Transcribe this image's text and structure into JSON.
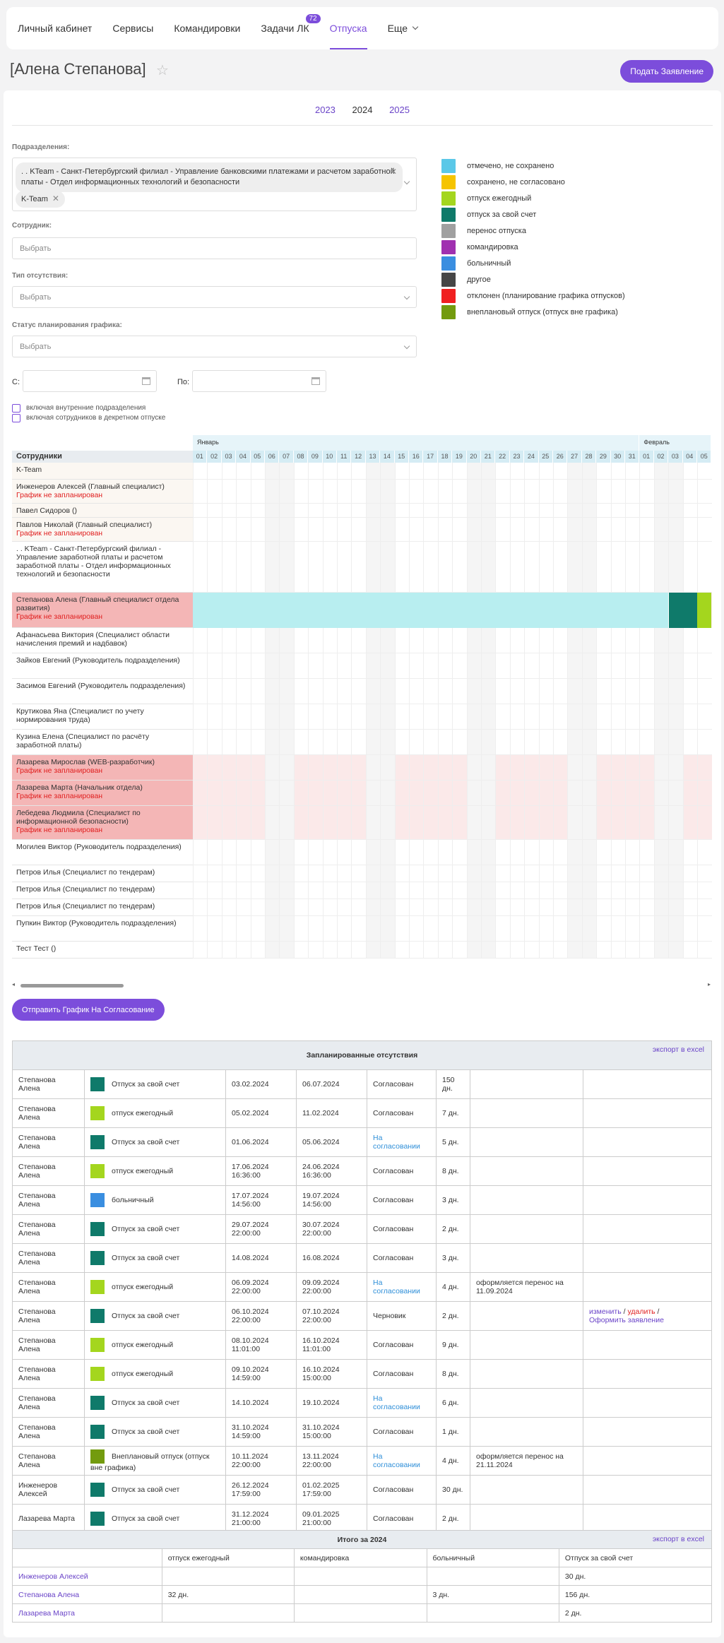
{
  "nav": {
    "items": [
      "Личный кабинет",
      "Сервисы",
      "Командировки",
      "Задачи ЛК",
      "Отпуска",
      "Еще"
    ],
    "badge": "72",
    "active_index": 4
  },
  "page": {
    "title": "[Алена Степанова]",
    "apply_button": "Подать Заявление"
  },
  "years": [
    "2023",
    "2024",
    "2025"
  ],
  "filters": {
    "dept_label": "Подразделения:",
    "dept_chip1": ". . KTeam - Санкт-Петербургский филиал - Управление банковскими платежами и расчетом заработной платы - Отдел информационных технологий и безопасности",
    "dept_chip2": "K-Team",
    "employee_label": "Сотрудник:",
    "employee_placeholder": "Выбрать",
    "absence_label": "Тип отсутствия:",
    "absence_placeholder": "Выбрать",
    "status_label": "Статус планирования графика:",
    "status_placeholder": "Выбрать",
    "from_label": "С:",
    "to_label": "По:",
    "cb1": "включая внутренние подразделения",
    "cb2": "включая сотрудников в декретном отпуске"
  },
  "legend": [
    {
      "label": "отмечено, не сохранено",
      "color": "#5bc8e8"
    },
    {
      "label": "сохранено, не согласовано",
      "color": "#f5c400"
    },
    {
      "label": "отпуск ежегодный",
      "color": "#a4d61e"
    },
    {
      "label": "отпуск за свой счет",
      "color": "#0f7a6a"
    },
    {
      "label": "перенос отпуска",
      "color": "#a0a0a0"
    },
    {
      "label": "командировка",
      "color": "#a030b0"
    },
    {
      "label": "больничный",
      "color": "#3a8ee0"
    },
    {
      "label": "другое",
      "color": "#464646"
    },
    {
      "label": "отклонен (планирование графика отпусков)",
      "color": "#f02020"
    },
    {
      "label": "внеплановый отпуск (отпуск вне графика)",
      "color": "#739b0e"
    }
  ],
  "grid": {
    "header": "Сотрудники",
    "month1": "Январь",
    "month2": "Февраль",
    "days": [
      "01",
      "02",
      "03",
      "04",
      "05",
      "06",
      "07",
      "08",
      "09",
      "10",
      "11",
      "12",
      "13",
      "14",
      "15",
      "16",
      "17",
      "18",
      "19",
      "20",
      "21",
      "22",
      "23",
      "24",
      "25",
      "26",
      "27",
      "28",
      "29",
      "30",
      "31",
      "01",
      "02",
      "03",
      "04",
      "05"
    ],
    "rows": [
      {
        "name": "K-Team",
        "note": ""
      },
      {
        "name": "Инженеров Алексей (Главный специалист)",
        "note": "График не запланирован"
      },
      {
        "name": "Павел Сидоров ()",
        "note": ""
      },
      {
        "name": "Павлов Николай (Главный специалист)",
        "note": "График не запланирован"
      },
      {
        "name": ". . KTeam - Санкт-Петербургский филиал - Управление заработной платы и расчетом заработной платы - Отдел информационных технологий и безопасности",
        "note": ""
      },
      {
        "name": "Степанова Алена (Главный специалист отдела развития)",
        "note": "График не запланирован"
      },
      {
        "name": "Афанасьева Виктория (Специалист области начисления премий и надбавок)",
        "note": ""
      },
      {
        "name": "Зайков Евгений (Руководитель подразделения)",
        "note": ""
      },
      {
        "name": "Засимов Евгений (Руководитель подразделения)",
        "note": ""
      },
      {
        "name": "Крутикова Яна (Специалист по учету нормирования труда)",
        "note": ""
      },
      {
        "name": "Кузина Елена (Специалист по расчёту заработной платы)",
        "note": ""
      },
      {
        "name": "Лазарева Мирослав (WEB-разработчик)",
        "note": "График не запланирован"
      },
      {
        "name": "Лазарева Марта (Начальник отдела)",
        "note": "График не запланирован"
      },
      {
        "name": "Лебедева Людмила (Специалист по информационной безопасности)",
        "note": "График не запланирован"
      },
      {
        "name": "Могилев Виктор (Руководитель подразделения)",
        "note": ""
      },
      {
        "name": "Петров Илья (Специалист по тендерам)",
        "note": ""
      },
      {
        "name": "Петров Илья (Специалист по тендерам)",
        "note": ""
      },
      {
        "name": "Петров Илья (Специалист по тендерам)",
        "note": ""
      },
      {
        "name": "Пупкин Виктор (Руководитель подразделения)",
        "note": ""
      },
      {
        "name": "Тест Тест ()",
        "note": ""
      }
    ]
  },
  "send_button": "Отправить График На Согласование",
  "planned": {
    "title": "Запланированные отсутствия",
    "export": "экспорт в excel",
    "rows": [
      {
        "emp": "Степанова Алена",
        "color": "#0f7a6a",
        "type": "Отпуск за свой счет",
        "from": "03.02.2024",
        "to": "06.07.2024",
        "status": "Согласован",
        "days": "150 дн.",
        "note": "",
        "action": ""
      },
      {
        "emp": "Степанова Алена",
        "color": "#a4d61e",
        "type": "отпуск ежегодный",
        "from": "05.02.2024",
        "to": "11.02.2024",
        "status": "Согласован",
        "days": "7 дн.",
        "note": "",
        "action": ""
      },
      {
        "emp": "Степанова Алена",
        "color": "#0f7a6a",
        "type": "Отпуск за свой счет",
        "from": "01.06.2024",
        "to": "05.06.2024",
        "status": "На согласовании",
        "days": "5 дн.",
        "note": "",
        "action": ""
      },
      {
        "emp": "Степанова Алена",
        "color": "#a4d61e",
        "type": "отпуск ежегодный",
        "from": "17.06.2024 16:36:00",
        "to": "24.06.2024 16:36:00",
        "status": "Согласован",
        "days": "8 дн.",
        "note": "",
        "action": ""
      },
      {
        "emp": "Степанова Алена",
        "color": "#3a8ee0",
        "type": "больничный",
        "from": "17.07.2024 14:56:00",
        "to": "19.07.2024 14:56:00",
        "status": "Согласован",
        "days": "3 дн.",
        "note": "",
        "action": ""
      },
      {
        "emp": "Степанова Алена",
        "color": "#0f7a6a",
        "type": "Отпуск за свой счет",
        "from": "29.07.2024 22:00:00",
        "to": "30.07.2024 22:00:00",
        "status": "Согласован",
        "days": "2 дн.",
        "note": "",
        "action": ""
      },
      {
        "emp": "Степанова Алена",
        "color": "#0f7a6a",
        "type": "Отпуск за свой счет",
        "from": "14.08.2024",
        "to": "16.08.2024",
        "status": "Согласован",
        "days": "3 дн.",
        "note": "",
        "action": ""
      },
      {
        "emp": "Степанова Алена",
        "color": "#a4d61e",
        "type": "отпуск ежегодный",
        "from": "06.09.2024 22:00:00",
        "to": "09.09.2024 22:00:00",
        "status": "На согласовании",
        "days": "4 дн.",
        "note": "оформляется перенос на 11.09.2024",
        "action": ""
      },
      {
        "emp": "Степанова Алена",
        "color": "#0f7a6a",
        "type": "Отпуск за свой счет",
        "from": "06.10.2024 22:00:00",
        "to": "07.10.2024 22:00:00",
        "status": "Черновик",
        "days": "2 дн.",
        "note": "",
        "action": "edit"
      },
      {
        "emp": "Степанова Алена",
        "color": "#a4d61e",
        "type": "отпуск ежегодный",
        "from": "08.10.2024 11:01:00",
        "to": "16.10.2024 11:01:00",
        "status": "Согласован",
        "days": "9 дн.",
        "note": "",
        "action": ""
      },
      {
        "emp": "Степанова Алена",
        "color": "#a4d61e",
        "type": "отпуск ежегодный",
        "from": "09.10.2024 14:59:00",
        "to": "16.10.2024 15:00:00",
        "status": "Согласован",
        "days": "8 дн.",
        "note": "",
        "action": ""
      },
      {
        "emp": "Степанова Алена",
        "color": "#0f7a6a",
        "type": "Отпуск за свой счет",
        "from": "14.10.2024",
        "to": "19.10.2024",
        "status": "На согласовании",
        "days": "6 дн.",
        "note": "",
        "action": ""
      },
      {
        "emp": "Степанова Алена",
        "color": "#0f7a6a",
        "type": "Отпуск за свой счет",
        "from": "31.10.2024 14:59:00",
        "to": "31.10.2024 15:00:00",
        "status": "Согласован",
        "days": "1 дн.",
        "note": "",
        "action": ""
      },
      {
        "emp": "Степанова Алена",
        "color": "#739b0e",
        "type": "Внеплановый отпуск (отпуск вне графика)",
        "from": "10.11.2024 22:00:00",
        "to": "13.11.2024 22:00:00",
        "status": "На согласовании",
        "days": "4 дн.",
        "note": "оформляется перенос на 21.11.2024",
        "action": ""
      },
      {
        "emp": "Инженеров Алексей",
        "color": "#0f7a6a",
        "type": "Отпуск за свой счет",
        "from": "26.12.2024 17:59:00",
        "to": "01.02.2025 17:59:00",
        "status": "Согласован",
        "days": "30 дн.",
        "note": "",
        "action": ""
      },
      {
        "emp": "Лазарева Марта",
        "color": "#0f7a6a",
        "type": "Отпуск за свой счет",
        "from": "31.12.2024 21:00:00",
        "to": "09.01.2025 21:00:00",
        "status": "Согласован",
        "days": "2 дн.",
        "note": "",
        "action": ""
      }
    ],
    "act_edit": "изменить",
    "act_delete": "удалить",
    "act_apply": "Оформить заявление"
  },
  "totals": {
    "title": "Итого за 2024",
    "export": "экспорт в excel",
    "cols": [
      "",
      "отпуск ежегодный",
      "командировка",
      "больничный",
      "Отпуск за свой счет"
    ],
    "rows": [
      {
        "emp": "Инженеров Алексей",
        "vals": [
          "",
          "",
          "",
          "30 дн."
        ]
      },
      {
        "emp": "Степанова Алена",
        "vals": [
          "32 дн.",
          "",
          "3 дн.",
          "156 дн."
        ]
      },
      {
        "emp": "Лазарева Марта",
        "vals": [
          "",
          "",
          "",
          "2 дн."
        ]
      }
    ]
  }
}
